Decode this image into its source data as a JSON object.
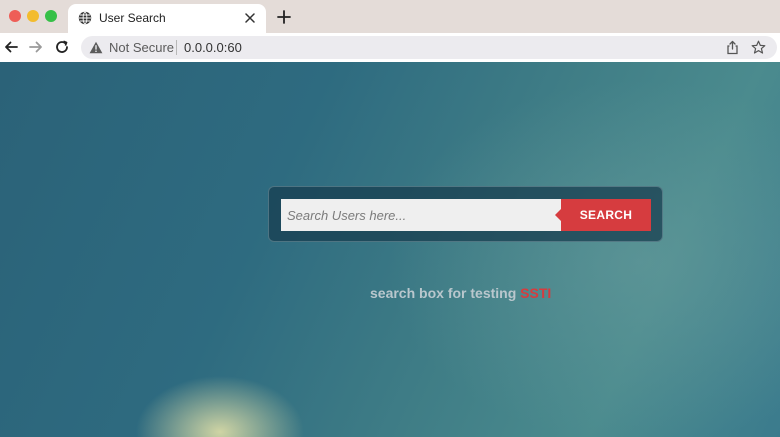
{
  "browser": {
    "tab_title": "User Search",
    "security_label": "Not Secure",
    "url": "0.0.0.0:60",
    "icons": {
      "tab": "globe-icon",
      "close": "close-icon",
      "new_tab": "plus-icon",
      "back": "arrow-left-icon",
      "forward": "arrow-right-icon",
      "reload": "reload-icon",
      "warning": "warning-icon",
      "share": "share-icon",
      "bookmark": "star-icon"
    }
  },
  "search": {
    "placeholder": "Search Users here...",
    "value": "",
    "button_label": "SEARCH"
  },
  "caption": {
    "text": "search box for testing ",
    "highlight": "SSTI"
  },
  "colors": {
    "accent": "#d63c3f",
    "page_bg": "#2f6b80",
    "caption": "#b9c7cd"
  }
}
